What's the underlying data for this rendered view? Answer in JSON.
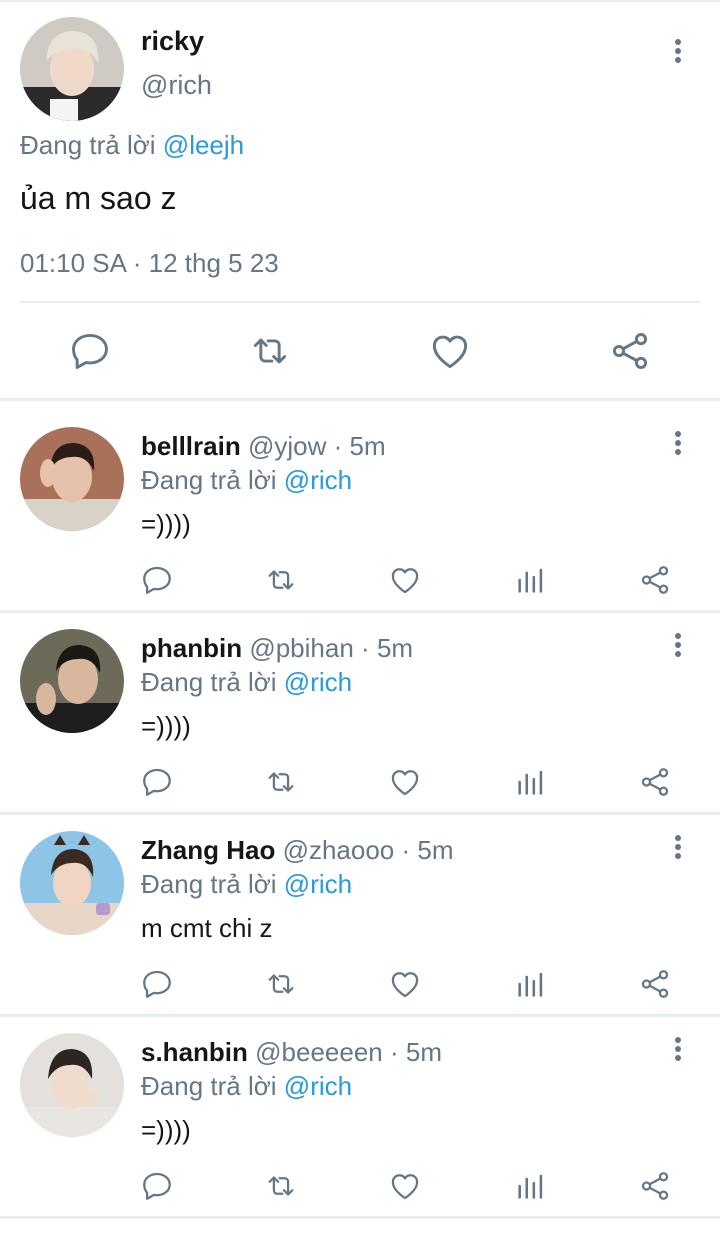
{
  "main_tweet": {
    "name": "ricky",
    "handle": "@rich",
    "replying_prefix": "Đang trả lời",
    "replying_to": "@leejh",
    "text": "ủa m sao z",
    "timestamp": "01:10 SA · 12 thg 5 23",
    "avatar_colors": {
      "bg": "#cfcac4",
      "hair": "#e8e2d8",
      "face": "#f1d9c9",
      "shirt": "#2b2b2b"
    }
  },
  "replies": [
    {
      "name": "belllrain",
      "handle": "@yjow",
      "age": "5m",
      "replying_prefix": "Đang trả lời",
      "replying_to": "@rich",
      "text": "=))))",
      "avatar_colors": {
        "bg": "#a9705a",
        "hair": "#2a1c16",
        "face": "#e6c2aa",
        "shirt": "#d9d2c8"
      }
    },
    {
      "name": "phanbin",
      "handle": "@pbihan",
      "age": "5m",
      "replying_prefix": "Đang trả lời",
      "replying_to": "@rich",
      "text": "=))))",
      "avatar_colors": {
        "bg": "#6e6a5a",
        "hair": "#1b1714",
        "face": "#d9b79e",
        "shirt": "#1e1e1e"
      }
    },
    {
      "name": "Zhang Hao",
      "handle": "@zhaooo",
      "age": "5m",
      "replying_prefix": "Đang trả lời",
      "replying_to": "@rich",
      "text": "m cmt chi z",
      "avatar_colors": {
        "bg": "#8ec5e6",
        "hair": "#3a2a22",
        "face": "#f0d5c2",
        "shirt": "#e8d7c6"
      }
    },
    {
      "name": "s.hanbin",
      "handle": "@beeeeen",
      "age": "5m",
      "replying_prefix": "Đang trả lời",
      "replying_to": "@rich",
      "text": "=))))",
      "avatar_colors": {
        "bg": "#e4e1dc",
        "hair": "#2c2522",
        "face": "#f0dccd",
        "shirt": "#e9e6e2"
      }
    }
  ],
  "colors": {
    "text_primary": "#14171a",
    "text_secondary": "#657786",
    "link": "#2a9ad8",
    "divider": "#e6ecf0"
  },
  "icons": [
    "reply-icon",
    "retweet-icon",
    "like-icon",
    "analytics-icon",
    "share-icon",
    "more-icon"
  ]
}
